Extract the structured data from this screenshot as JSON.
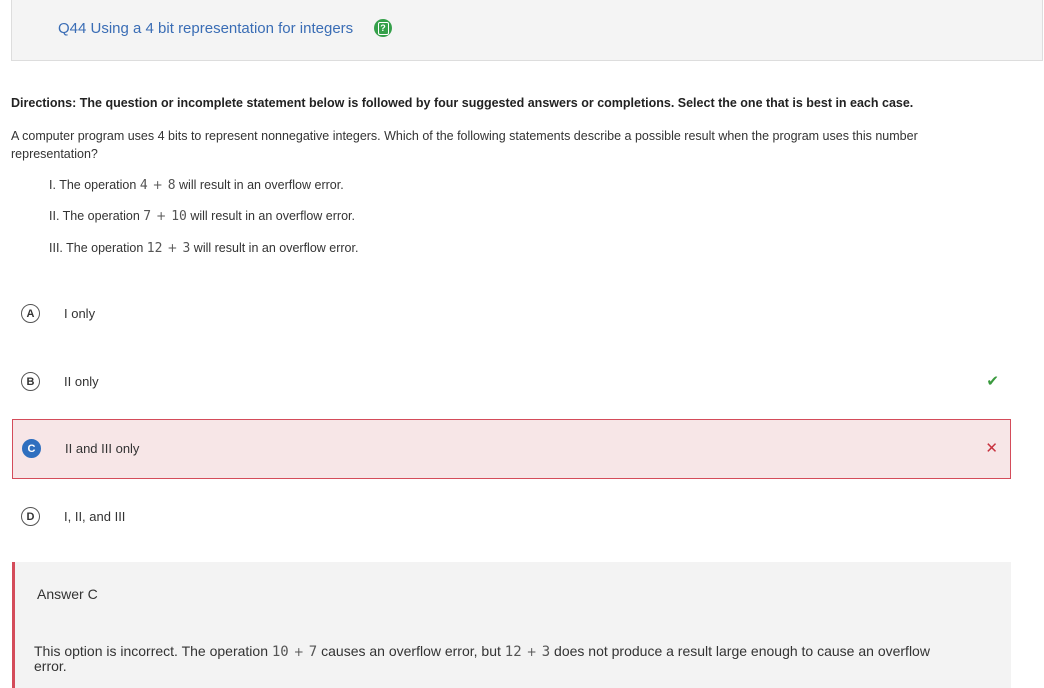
{
  "question": {
    "title": "Q44 Using a 4 bit representation for integers",
    "help_icon": "question-mark-icon"
  },
  "directions": "Directions: The question or incomplete statement below is followed by four suggested answers or completions. Select the one that is best in each case.",
  "stem": "A computer program uses 4 bits to represent nonnegative integers. Which of the following statements describe a possible result when the program uses this number representation?",
  "statements": [
    {
      "prefix": "I. The operation",
      "a": "4",
      "op": "+",
      "b": "8",
      "suffix": "will result in an overflow error."
    },
    {
      "prefix": "II. The operation",
      "a": "7",
      "op": "+",
      "b": "10",
      "suffix": "will result in an overflow error."
    },
    {
      "prefix": "III. The operation",
      "a": "12",
      "op": "+",
      "b": "3",
      "suffix": "will result in an overflow error."
    }
  ],
  "choices": [
    {
      "letter": "A",
      "text": "I only",
      "selected": false,
      "mark": ""
    },
    {
      "letter": "B",
      "text": "II only",
      "selected": false,
      "mark": "✔"
    },
    {
      "letter": "C",
      "text": "II and III only",
      "selected": true,
      "mark": "✕"
    },
    {
      "letter": "D",
      "text": "I, II, and III",
      "selected": false,
      "mark": ""
    }
  ],
  "answer": {
    "title": "Answer C",
    "exp_part1": "This option is incorrect. The operation",
    "exp_code1_a": "10",
    "exp_code1_op": "+",
    "exp_code1_b": "7",
    "exp_part2": "causes an overflow error, but",
    "exp_code2_a": "12",
    "exp_code2_op": "+",
    "exp_code2_b": "3",
    "exp_part3": "does not produce a result large enough to cause an overflow error."
  },
  "colors": {
    "title_blue": "#3a6db5",
    "help_green": "#35a04a",
    "selected_bg": "#f7e6e7",
    "selected_border": "#d44c5a",
    "correct_green": "#3a9a3e",
    "incorrect_red": "#c8323f"
  }
}
